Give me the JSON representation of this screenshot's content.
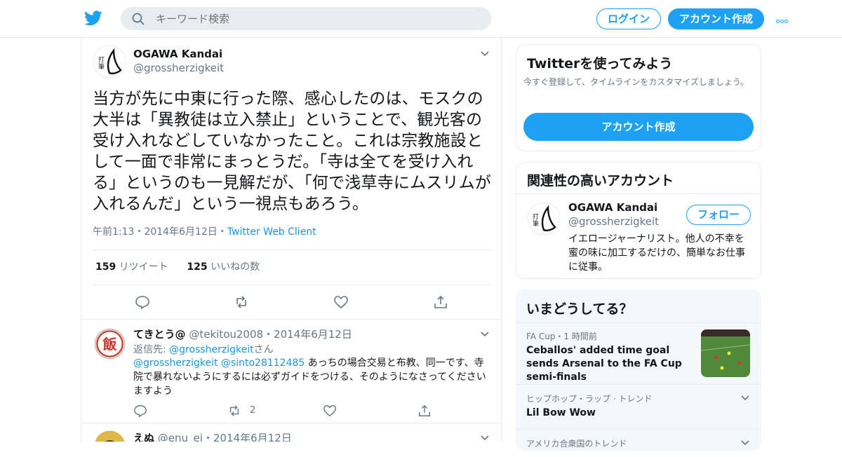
{
  "search": {
    "placeholder": "キーワード検索"
  },
  "header": {
    "login": "ログイン",
    "signup": "アカウント作成"
  },
  "tweet": {
    "name": "OGAWA Kandai",
    "handle": "@grossherzigkeit",
    "text": "当方が先に中東に行った際、感心したのは、モスクの大半は「異教徒は立入禁止」ということで、観光客の受け入れなどしていなかったこと。これは宗教施設として一面で非常にまっとうだ。「寺は全てを受け入れる」というのも一見解だが、「何で浅草寺にムスリムが入れるんだ」という一視点もあろう。",
    "time": "午前1:13・2014年6月12日・",
    "client": "Twitter Web Client",
    "retweets_count": "159",
    "retweets_label": "リツイート",
    "likes_count": "125",
    "likes_label": "いいねの数"
  },
  "replies": [
    {
      "name": "てきとう@",
      "handle": "@tekitou2008",
      "date": "・2014年6月12日",
      "avatar_glyph": "飯",
      "replyto_label": "返信先: ",
      "replyto_user": "@grossherzigkeit",
      "replyto_suffix": "さん",
      "mention1": "@grossherzigkeit",
      "mention2": "@sinto28112485",
      "text": " あっちの場合交易と布教、同一です、寺院で暴れないようにするには必ずガイドをつける、そのようになさってくださいますよう",
      "retweet_count": "2"
    },
    {
      "name": "えぬ",
      "handle": "@enu_ei",
      "date": "・2014年6月12日"
    }
  ],
  "try_card": {
    "title": "Twitterを使ってみよう",
    "subtitle": "今すぐ登録して、タイムラインをカスタマイズしましょう。",
    "button": "アカウント作成"
  },
  "related": {
    "title": "関連性の高いアカウント",
    "name": "OGAWA Kandai",
    "handle": "@grossherzigkeit",
    "follow": "フォロー",
    "bio": "イエロージャーナリスト。他人の不幸を蜜の味に加工するだけの、簡単なお仕事に従事。"
  },
  "trends": {
    "title": "いまどうしてる？",
    "items": [
      {
        "context": "FA Cup・1 時間前",
        "title": "Ceballos' added time goal sends Arsenal to the FA Cup semi-finals"
      },
      {
        "context": "ヒップホップ・ラップ · トレンド",
        "title": "Lil Bow Wow"
      },
      {
        "context": "アメリカ合衆国のトレンド",
        "title": ""
      }
    ]
  },
  "colors": {
    "accent": "#1da1f2",
    "link": "#1b95e0",
    "muted": "#657786",
    "text": "#14171a",
    "border": "#e6ecf0"
  }
}
